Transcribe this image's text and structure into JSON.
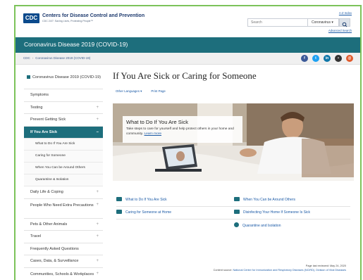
{
  "header": {
    "org_name": "Centers for Disease Control and Prevention",
    "org_tagline": "CDC 24/7: Saving Lives, Protecting People™",
    "logo_text": "CDC",
    "az_link": "A-Z Index",
    "search_placeholder": "Search",
    "search_scope": "Coronavirus ▾",
    "advanced_search": "Advanced Search"
  },
  "title_bar": {
    "label": "Coronavirus Disease 2019 (COVID-19)"
  },
  "breadcrumb": [
    "CDC",
    "Coronavirus Disease 2019 (COVID-19)"
  ],
  "social": [
    {
      "icon": "facebook-icon",
      "glyph": "f",
      "color": "#3b5998"
    },
    {
      "icon": "twitter-icon",
      "glyph": "t",
      "color": "#1da1f2"
    },
    {
      "icon": "linkedin-icon",
      "glyph": "in",
      "color": "#0e76a8"
    },
    {
      "icon": "syndicate-icon",
      "glyph": "•",
      "color": "#333333"
    },
    {
      "icon": "email-icon",
      "glyph": "@",
      "color": "#e05a2b"
    }
  ],
  "sidebar": {
    "home": "Coronavirus Disease 2019 (COVID-19)",
    "items": [
      "Symptoms",
      "Testing",
      "Prevent Getting Sick",
      "If You Are Sick",
      "What to Do If You Are Sick",
      "Caring for Someone",
      "When You Can be Around Others",
      "Quarantine & Isolation",
      "Daily Life & Coping",
      "People Who Need Extra Precautions",
      "Pets & Other Animals",
      "Travel",
      "Frequently Asked Questions",
      "Cases, Data, & Surveillance",
      "Communities, Schools & Workplaces"
    ]
  },
  "main": {
    "title": "If You Are Sick or Caring for Someone",
    "other_languages": "Other Languages ▾",
    "print_page": "Print Page",
    "hero": {
      "title": "What to Do If You Are Sick",
      "text": "Take steps to care for yourself and help protect others in your home and community.",
      "link": "Learn more"
    },
    "links": [
      "What to Do If You Are Sick",
      "When You Can be Around Others",
      "Caring for Someone at Home",
      "Disinfecting Your Home If Someone Is Sick",
      "Quarantine and Isolation"
    ]
  },
  "footer": {
    "reviewed": "Page last reviewed: May 24, 2020",
    "source_label": "Content source:",
    "source": "National Center for Immunization and Respiratory Diseases (NCIRD), Division of Viral Diseases"
  },
  "colors": {
    "teal": "#1d6e7c",
    "link": "#1b5aa6",
    "frame": "#7cc35a"
  }
}
